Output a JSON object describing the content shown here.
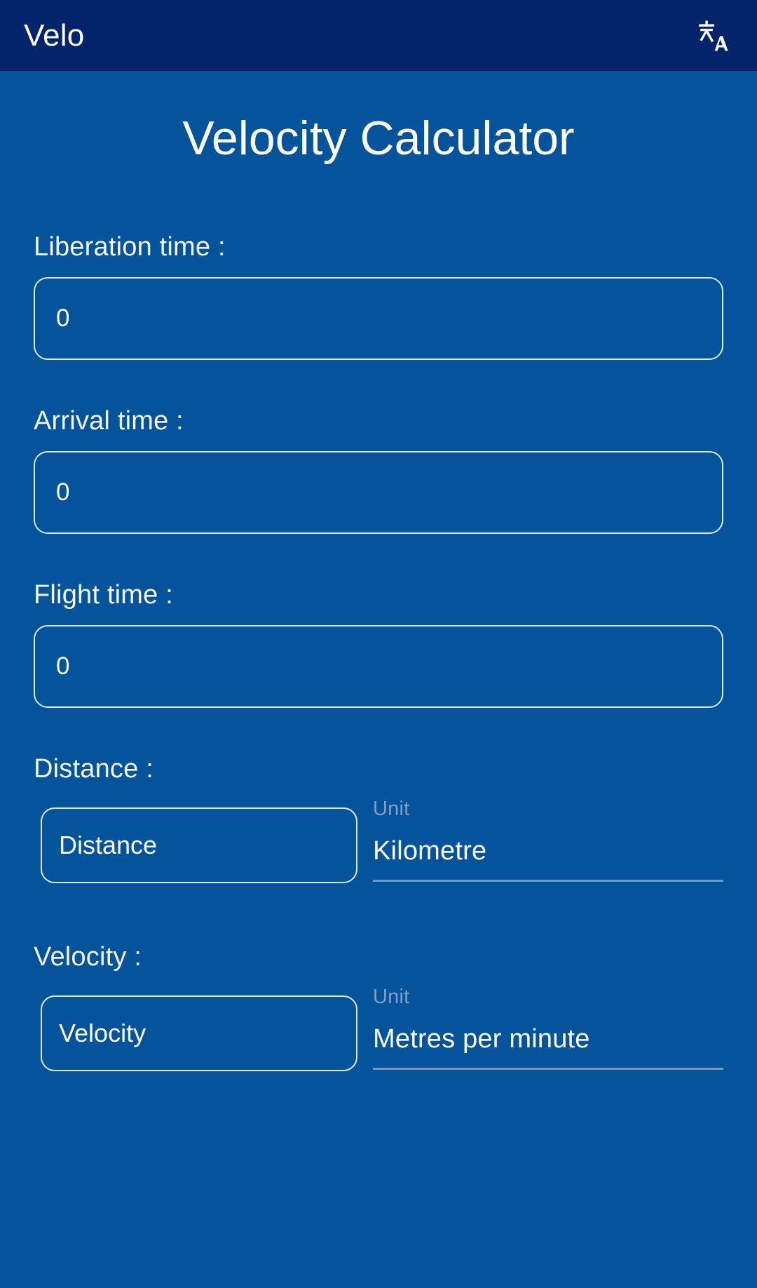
{
  "appbar": {
    "title": "Velo",
    "translate_icon": "translate-icon"
  },
  "page": {
    "title": "Velocity Calculator"
  },
  "fields": {
    "liberation_time": {
      "label": "Liberation time :",
      "value": "0",
      "placeholder": "0"
    },
    "arrival_time": {
      "label": "Arrival time :",
      "value": "0",
      "placeholder": "0"
    },
    "flight_time": {
      "label": "Flight time :",
      "value": "0",
      "placeholder": "0"
    },
    "distance": {
      "label": "Distance :",
      "value": "",
      "placeholder": "Distance",
      "unit_label": "Unit",
      "unit_value": "Kilometre"
    },
    "velocity": {
      "label": "Velocity :",
      "value": "",
      "placeholder": "Velocity",
      "unit_label": "Unit",
      "unit_value": "Metres per minute"
    }
  },
  "colors": {
    "appbar_bg": "#03246a",
    "body_bg": "#04539b",
    "text_primary": "#ffffff",
    "unit_label": "#7fa1cb",
    "border": "#dce9f4",
    "underline": "#6f98c6"
  }
}
